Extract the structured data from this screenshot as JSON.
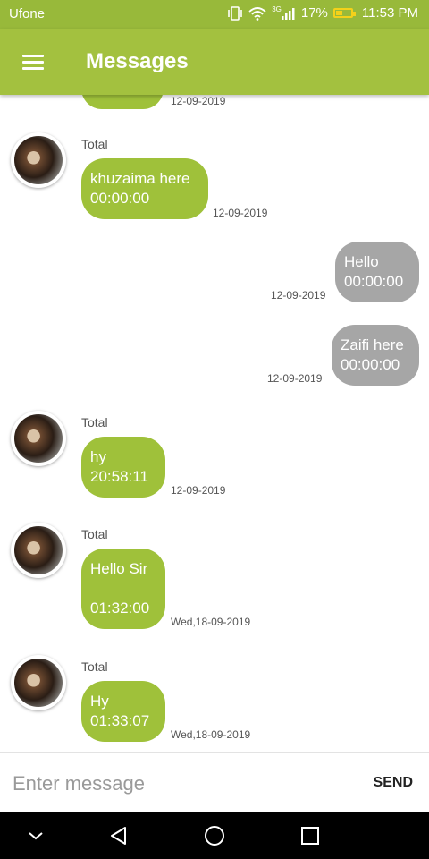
{
  "status_bar": {
    "carrier": "Ufone",
    "network": "3G",
    "battery": "17%",
    "time": "11:53 PM"
  },
  "app_bar": {
    "title": "Messages"
  },
  "messages": [
    {
      "direction": "in",
      "sender": "",
      "lines": [],
      "time": "12-09-2019"
    },
    {
      "direction": "in",
      "sender": "Total",
      "lines": [
        "khuzaima here",
        "00:00:00"
      ],
      "time": "12-09-2019"
    },
    {
      "direction": "out",
      "sender": "",
      "lines": [
        "Hello",
        "00:00:00"
      ],
      "time": "12-09-2019"
    },
    {
      "direction": "out",
      "sender": "",
      "lines": [
        "Zaifi here",
        "00:00:00"
      ],
      "time": "12-09-2019"
    },
    {
      "direction": "in",
      "sender": "Total",
      "lines": [
        "hy",
        "20:58:11"
      ],
      "time": "12-09-2019"
    },
    {
      "direction": "in",
      "sender": "Total",
      "lines": [
        "Hello Sir",
        "",
        "01:32:00"
      ],
      "time": "Wed,18-09-2019"
    },
    {
      "direction": "in",
      "sender": "Total",
      "lines": [
        "Hy",
        "01:33:07"
      ],
      "time": "Wed,18-09-2019"
    }
  ],
  "input": {
    "placeholder": "Enter message",
    "value": ""
  },
  "send_label": "SEND",
  "colors": {
    "status_bar": "#98b93a",
    "app_bar": "#a3c13f",
    "incoming_bubble": "#9fc13a",
    "outgoing_bubble": "#a6a6a6"
  }
}
